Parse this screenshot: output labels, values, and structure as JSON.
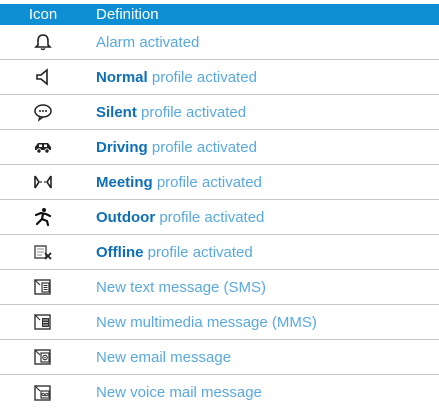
{
  "header": {
    "icon_col": "Icon",
    "definition_col": "Definition"
  },
  "colors": {
    "header_bg": "#0e8fd3",
    "keyword": "#0e6fb6",
    "text": "#5aa9dd",
    "divider": "#c7c7c7"
  },
  "rows": [
    {
      "icon": "alarm-bell-icon",
      "keyword": "",
      "text": "Alarm activated"
    },
    {
      "icon": "speaker-icon",
      "keyword": "Normal",
      "text": " profile activated"
    },
    {
      "icon": "speech-bubble-icon",
      "keyword": "Silent",
      "text": " profile activated"
    },
    {
      "icon": "car-icon",
      "keyword": "Driving",
      "text": " profile activated"
    },
    {
      "icon": "meeting-icon",
      "keyword": "Meeting",
      "text": " profile activated"
    },
    {
      "icon": "running-man-icon",
      "keyword": "Outdoor",
      "text": " profile activated"
    },
    {
      "icon": "offline-icon",
      "keyword": "Offline",
      "text": " profile activated"
    },
    {
      "icon": "sms-icon",
      "keyword": "",
      "text": "New text message (SMS)"
    },
    {
      "icon": "mms-icon",
      "keyword": "",
      "text": "New multimedia message (MMS)"
    },
    {
      "icon": "email-icon",
      "keyword": "",
      "text": "New email message"
    },
    {
      "icon": "voicemail-icon",
      "keyword": "",
      "text": "New voice mail message"
    }
  ]
}
